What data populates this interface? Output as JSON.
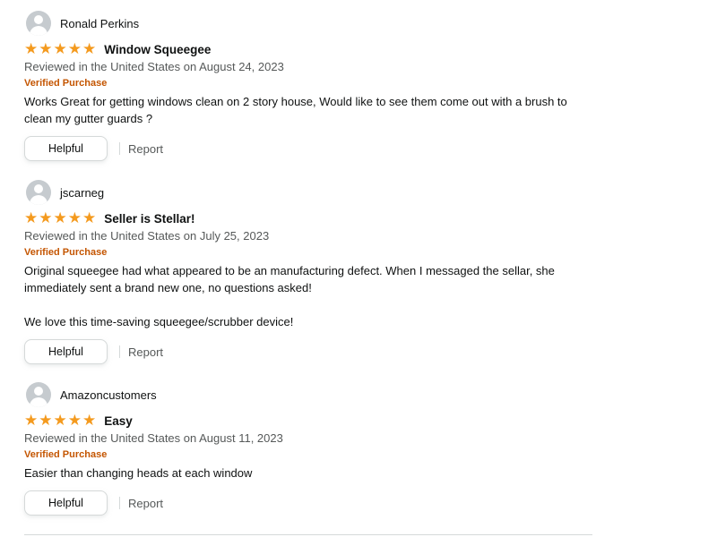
{
  "reviews": [
    {
      "author": "Ronald Perkins",
      "rating": 5,
      "title": "Window Squeegee",
      "meta": "Reviewed in the United States on August 24, 2023",
      "verified": "Verified Purchase",
      "body": "Works Great for getting windows clean on 2 story house, Would like to see them come out with a brush to clean my gutter guards ?",
      "helpful_label": "Helpful",
      "report_label": "Report"
    },
    {
      "author": "jscarneg",
      "rating": 5,
      "title": "Seller is Stellar!",
      "meta": "Reviewed in the United States on July 25, 2023",
      "verified": "Verified Purchase",
      "body": "Original squeegee had what appeared to be an manufacturing defect. When I messaged the sellar, she immediately sent a brand new one, no questions asked!\n\nWe love this time-saving squeegee/scrubber device!",
      "helpful_label": "Helpful",
      "report_label": "Report"
    },
    {
      "author": "Amazoncustomers",
      "rating": 5,
      "title": "Easy",
      "meta": "Reviewed in the United States on August 11, 2023",
      "verified": "Verified Purchase",
      "body": "Easier than changing heads at each window",
      "helpful_label": "Helpful",
      "report_label": "Report"
    }
  ],
  "colors": {
    "star": "#f49a1e",
    "verified": "#c45500",
    "muted": "#565959"
  }
}
